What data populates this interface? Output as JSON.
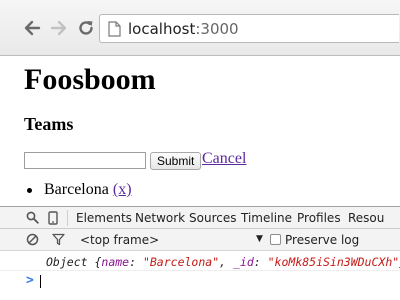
{
  "browser": {
    "url_host": "localhost",
    "url_port": ":3000"
  },
  "page": {
    "title": "Foosboom",
    "section_title": "Teams",
    "form": {
      "input_value": "",
      "submit_label": "Submit",
      "cancel_label": "Cancel"
    },
    "teams": [
      {
        "name": "Barcelona",
        "remove_label": "(x)"
      }
    ]
  },
  "devtools": {
    "tabs": [
      "Elements",
      "Network",
      "Sources",
      "Timeline",
      "Profiles",
      "Resou"
    ],
    "frame_label": "<top frame>",
    "preserve_log_label": "Preserve log",
    "preserve_log_checked": false,
    "console_log": {
      "prefix": "Object {",
      "key1": "name",
      "val1": "\"Barcelona\"",
      "sep": ", ",
      "key2": "_id",
      "val2": "\"koMk85iSin3WDuCXh\"",
      "suffix": "}"
    },
    "prompt_symbol": ">"
  },
  "colors": {
    "link_visited": "#5b2a9c",
    "console_string": "#c41a16",
    "console_key": "#881391",
    "prompt_blue": "#367cf1"
  }
}
